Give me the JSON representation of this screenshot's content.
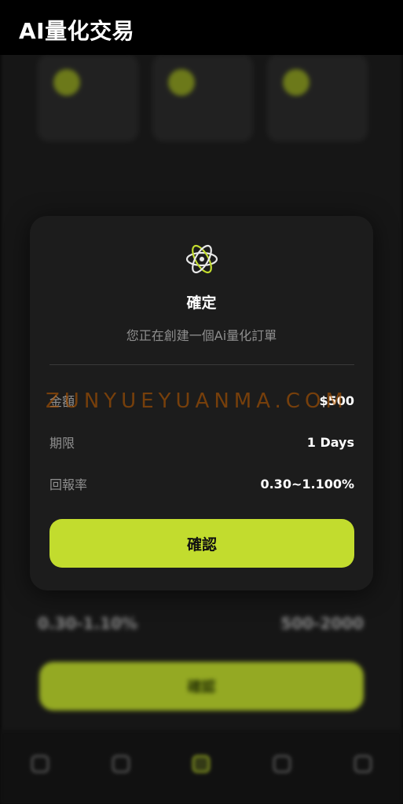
{
  "header": {
    "title": "AI量化交易"
  },
  "background": {
    "cards": [
      {
        "label": "",
        "icon": "shield-icon"
      },
      {
        "label": "",
        "icon": "search-icon"
      },
      {
        "label": "",
        "icon": "document-icon"
      }
    ],
    "stats": {
      "left_value": "0.30-1.10%",
      "right_value": "500-2000"
    },
    "button_label": "確認"
  },
  "tabbar": {
    "tabs": [
      {
        "label": "",
        "icon": "home-icon",
        "active": false
      },
      {
        "label": "",
        "icon": "chart-icon",
        "active": false
      },
      {
        "label": "",
        "icon": "ai-icon",
        "active": true
      },
      {
        "label": "",
        "icon": "search-icon",
        "active": false
      },
      {
        "label": "",
        "icon": "user-icon",
        "active": false
      }
    ]
  },
  "modal": {
    "title": "確定",
    "subtitle": "您正在創建一個Ai量化訂單",
    "rows": [
      {
        "key": "金額",
        "value": "$500"
      },
      {
        "key": "期限",
        "value": "1 Days"
      },
      {
        "key": "回報率",
        "value": "0.30~1.100%"
      }
    ],
    "confirm_label": "確認",
    "logo_icon": "atom-icon"
  },
  "watermark": "ZUNYUEYUANMA.COM",
  "colors": {
    "accent": "#c2dc2e",
    "background": "#1a1a1a",
    "modal": "#1c1c1c"
  }
}
